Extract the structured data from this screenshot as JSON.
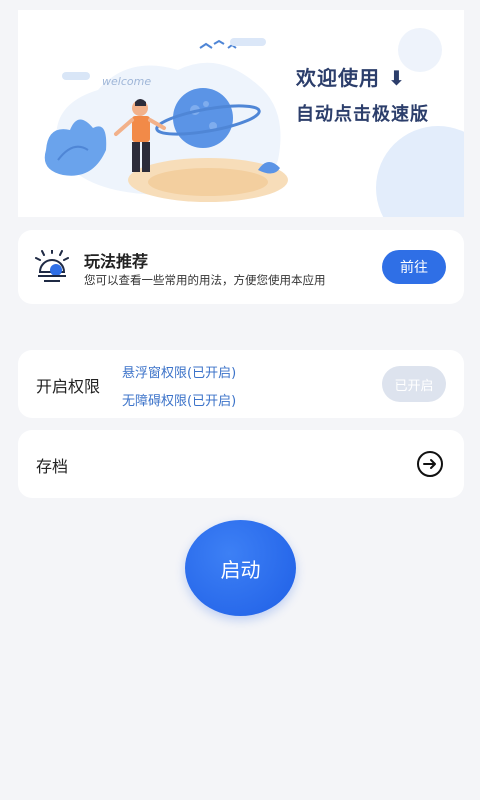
{
  "banner": {
    "title": "欢迎使用 ⬇",
    "subtitle": "自动点击极速版",
    "welcome_text": "welcome"
  },
  "tips_card": {
    "title": "玩法推荐",
    "description": "您可以查看一些常用的用法，方便您使用本应用",
    "button_label": "前往",
    "icon": "lightbulb-icon"
  },
  "permissions_card": {
    "title": "开启权限",
    "items": [
      "悬浮窗权限(已开启)",
      "无障碍权限(已开启)"
    ],
    "button_label": "已开启"
  },
  "archive_card": {
    "title": "存档",
    "icon": "arrow-right-circle-icon"
  },
  "start_button": {
    "label": "启动"
  },
  "colors": {
    "primary": "#2f6fe6",
    "link_blue": "#3c73c9",
    "title_navy": "#2c3e6b",
    "background": "#f4f5f8",
    "disabled": "#dde3ee"
  }
}
